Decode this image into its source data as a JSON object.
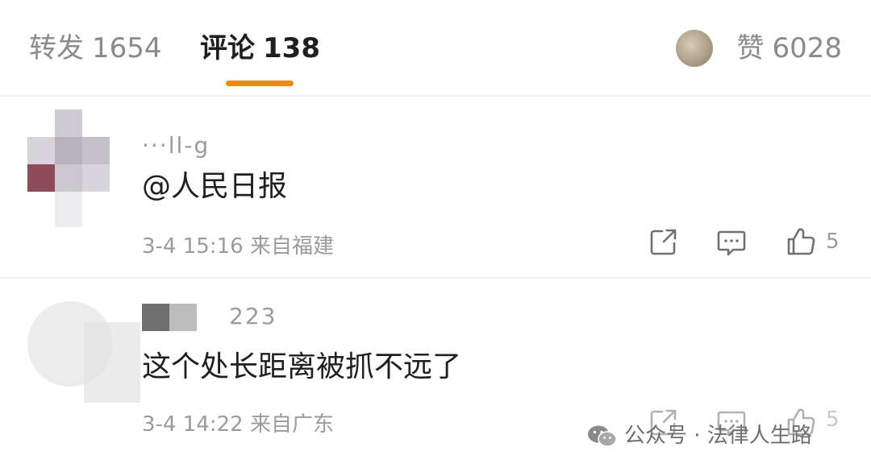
{
  "tabs": {
    "repost": {
      "label": "转发",
      "count": "1654"
    },
    "comments": {
      "label": "评论",
      "count": "138"
    },
    "likes": {
      "label": "赞",
      "count": "6028"
    }
  },
  "comments": [
    {
      "username": "···ll-g",
      "text": "@人民日报",
      "time": "3-4 15:16",
      "location": "来自福建",
      "like_count": "5"
    },
    {
      "username": "223",
      "text": "这个处长距离被抓不远了",
      "time": "3-4 14:22",
      "location": "来自广东",
      "like_count": "5"
    }
  ],
  "watermark": "公众号 · 法律人生路",
  "colors": {
    "accent": "#f08a00",
    "muted": "#9b9b9b",
    "text": "#1f1f1f"
  }
}
